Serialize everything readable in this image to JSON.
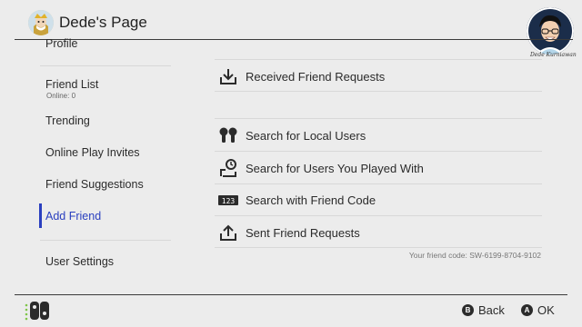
{
  "header": {
    "title": "Dede's Page",
    "signature": "Dede Kurniawan"
  },
  "sidebar": {
    "items": [
      {
        "label": "Profile"
      },
      {
        "label": "Friend List",
        "sub": "Online: 0"
      },
      {
        "label": "Trending"
      },
      {
        "label": "Online Play Invites"
      },
      {
        "label": "Friend Suggestions"
      },
      {
        "label": "Add Friend",
        "active": true
      },
      {
        "label": "User Settings"
      }
    ]
  },
  "main": {
    "items": [
      {
        "label": "Received Friend Requests",
        "icon": "inbox-download-icon"
      },
      {
        "label": "Search for Local Users",
        "icon": "local-users-icon"
      },
      {
        "label": "Search for Users You Played With",
        "icon": "played-with-icon"
      },
      {
        "label": "Search with Friend Code",
        "icon": "number-code-icon",
        "icon_text": "123"
      },
      {
        "label": "Sent Friend Requests",
        "icon": "outbox-upload-icon"
      }
    ],
    "friend_code": "Your friend code: SW-6199-8704-9102"
  },
  "footer": {
    "back": {
      "key": "B",
      "label": "Back"
    },
    "ok": {
      "key": "A",
      "label": "OK"
    }
  },
  "colors": {
    "background": "#ececec",
    "accent": "#2a3fbf",
    "text": "#2b2b2b",
    "joycon_left": "#2b2b2b",
    "joycon_dot": "#7fc64a"
  }
}
